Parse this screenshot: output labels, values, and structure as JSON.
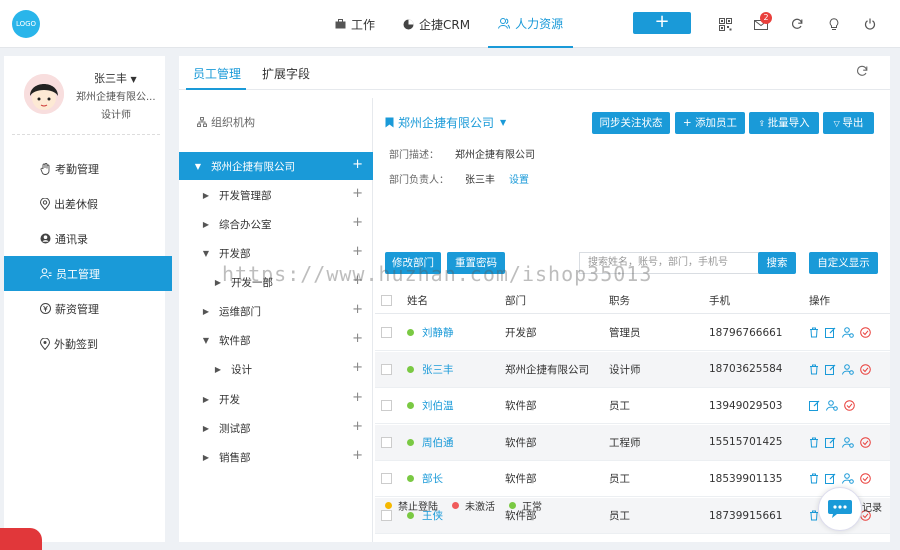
{
  "topbar": {
    "logo_text": "LOGO",
    "nav": [
      {
        "label": "工作",
        "icon": "briefcase-icon"
      },
      {
        "label": "企捷CRM",
        "icon": "pie-chart-icon"
      },
      {
        "label": "人力资源",
        "icon": "users-icon",
        "active": true
      }
    ],
    "add_label": "+",
    "message_badge": "2",
    "icons": [
      "qrcode-icon",
      "message-icon",
      "refresh-icon",
      "lightbulb-icon",
      "power-icon"
    ]
  },
  "sidebar": {
    "user_name": "张三丰",
    "company": "郑州企捷有限公...",
    "role": "设计师",
    "items": [
      {
        "label": "考勤管理",
        "icon": "hand-icon"
      },
      {
        "label": "出差休假",
        "icon": "location-icon"
      },
      {
        "label": "通讯录",
        "icon": "contact-icon"
      },
      {
        "label": "员工管理",
        "icon": "staff-icon",
        "active": true
      },
      {
        "label": "薪资管理",
        "icon": "salary-icon"
      },
      {
        "label": "外勤签到",
        "icon": "pin-icon"
      }
    ]
  },
  "tabs": [
    {
      "label": "员工管理",
      "active": true
    },
    {
      "label": "扩展字段"
    }
  ],
  "tree": {
    "title": "组织机构",
    "nodes": [
      {
        "label": "郑州企捷有限公司",
        "expanded": true,
        "selected": true
      },
      {
        "label": "开发管理部"
      },
      {
        "label": "综合办公室"
      },
      {
        "label": "开发部",
        "expanded": true
      },
      {
        "label": "开发一部"
      },
      {
        "label": "运维部门"
      },
      {
        "label": "软件部",
        "expanded": true
      },
      {
        "label": "设计"
      },
      {
        "label": "开发"
      },
      {
        "label": "测试部"
      },
      {
        "label": "销售部"
      }
    ],
    "plus": "+"
  },
  "detail": {
    "dept_name": "郑州企捷有限公司",
    "buttons": {
      "sync": "同步关注状态",
      "add": "添加员工",
      "import": "批量导入",
      "export": "导出",
      "edit_dept": "修改部门",
      "reset_pwd": "重置密码",
      "search": "搜索",
      "custom": "自定义显示"
    },
    "desc_label": "部门描述：",
    "desc_value": "郑州企捷有限公司",
    "owner_label": "部门负责人：",
    "owner_value": "张三丰",
    "owner_link": "设置",
    "search_placeholder": "搜索姓名，账号，部门，手机号"
  },
  "table": {
    "headers": [
      "姓名",
      "部门",
      "职务",
      "手机",
      "操作"
    ],
    "rows": [
      {
        "name": "刘静静",
        "dept": "开发部",
        "title": "管理员",
        "phone": "18796766661",
        "status": "green",
        "delete": true
      },
      {
        "name": "张三丰",
        "dept": "郑州企捷有限公司",
        "title": "设计师",
        "phone": "18703625584",
        "status": "green",
        "delete": true
      },
      {
        "name": "刘伯温",
        "dept": "软件部",
        "title": "员工",
        "phone": "13949029503",
        "status": "green",
        "delete": false
      },
      {
        "name": "周伯通",
        "dept": "软件部",
        "title": "工程师",
        "phone": "15515701425",
        "status": "green",
        "delete": true
      },
      {
        "name": "部长",
        "dept": "软件部",
        "title": "员工",
        "phone": "18539901135",
        "status": "green",
        "delete": true
      },
      {
        "name": "王侠",
        "dept": "软件部",
        "title": "员工",
        "phone": "18739915661",
        "status": "green",
        "delete": true
      }
    ]
  },
  "legend": [
    {
      "label": "禁止登陆",
      "color": "#f5b800"
    },
    {
      "label": "未激活",
      "color": "#f05b5b"
    },
    {
      "label": "正常",
      "color": "#7ac943"
    }
  ],
  "record_text": "记录",
  "watermark": "https://www.huzhan.com/ishop35013",
  "colors": {
    "accent": "#1a9ad8",
    "danger": "#e9403c"
  }
}
